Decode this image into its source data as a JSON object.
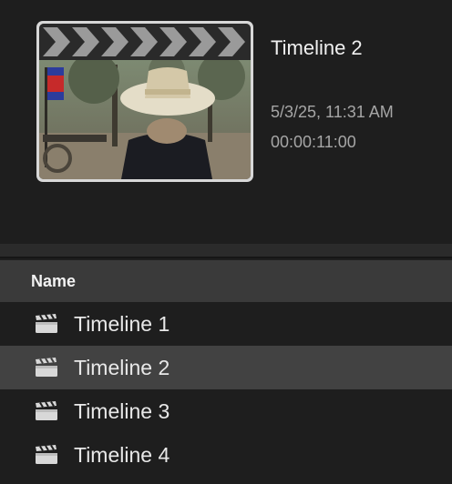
{
  "preview": {
    "title": "Timeline 2",
    "date": "5/3/25, 11:31 AM",
    "duration": "00:00:11:00"
  },
  "list": {
    "header": "Name",
    "selected_index": 1,
    "items": [
      {
        "label": "Timeline 1",
        "icon": "clapperboard-icon"
      },
      {
        "label": "Timeline 2",
        "icon": "clapperboard-icon"
      },
      {
        "label": "Timeline 3",
        "icon": "clapperboard-icon"
      },
      {
        "label": "Timeline 4",
        "icon": "clapperboard-icon"
      }
    ]
  },
  "colors": {
    "background": "#1e1e1e",
    "header_bg": "#3a3a3a",
    "selected_bg": "#424242"
  }
}
